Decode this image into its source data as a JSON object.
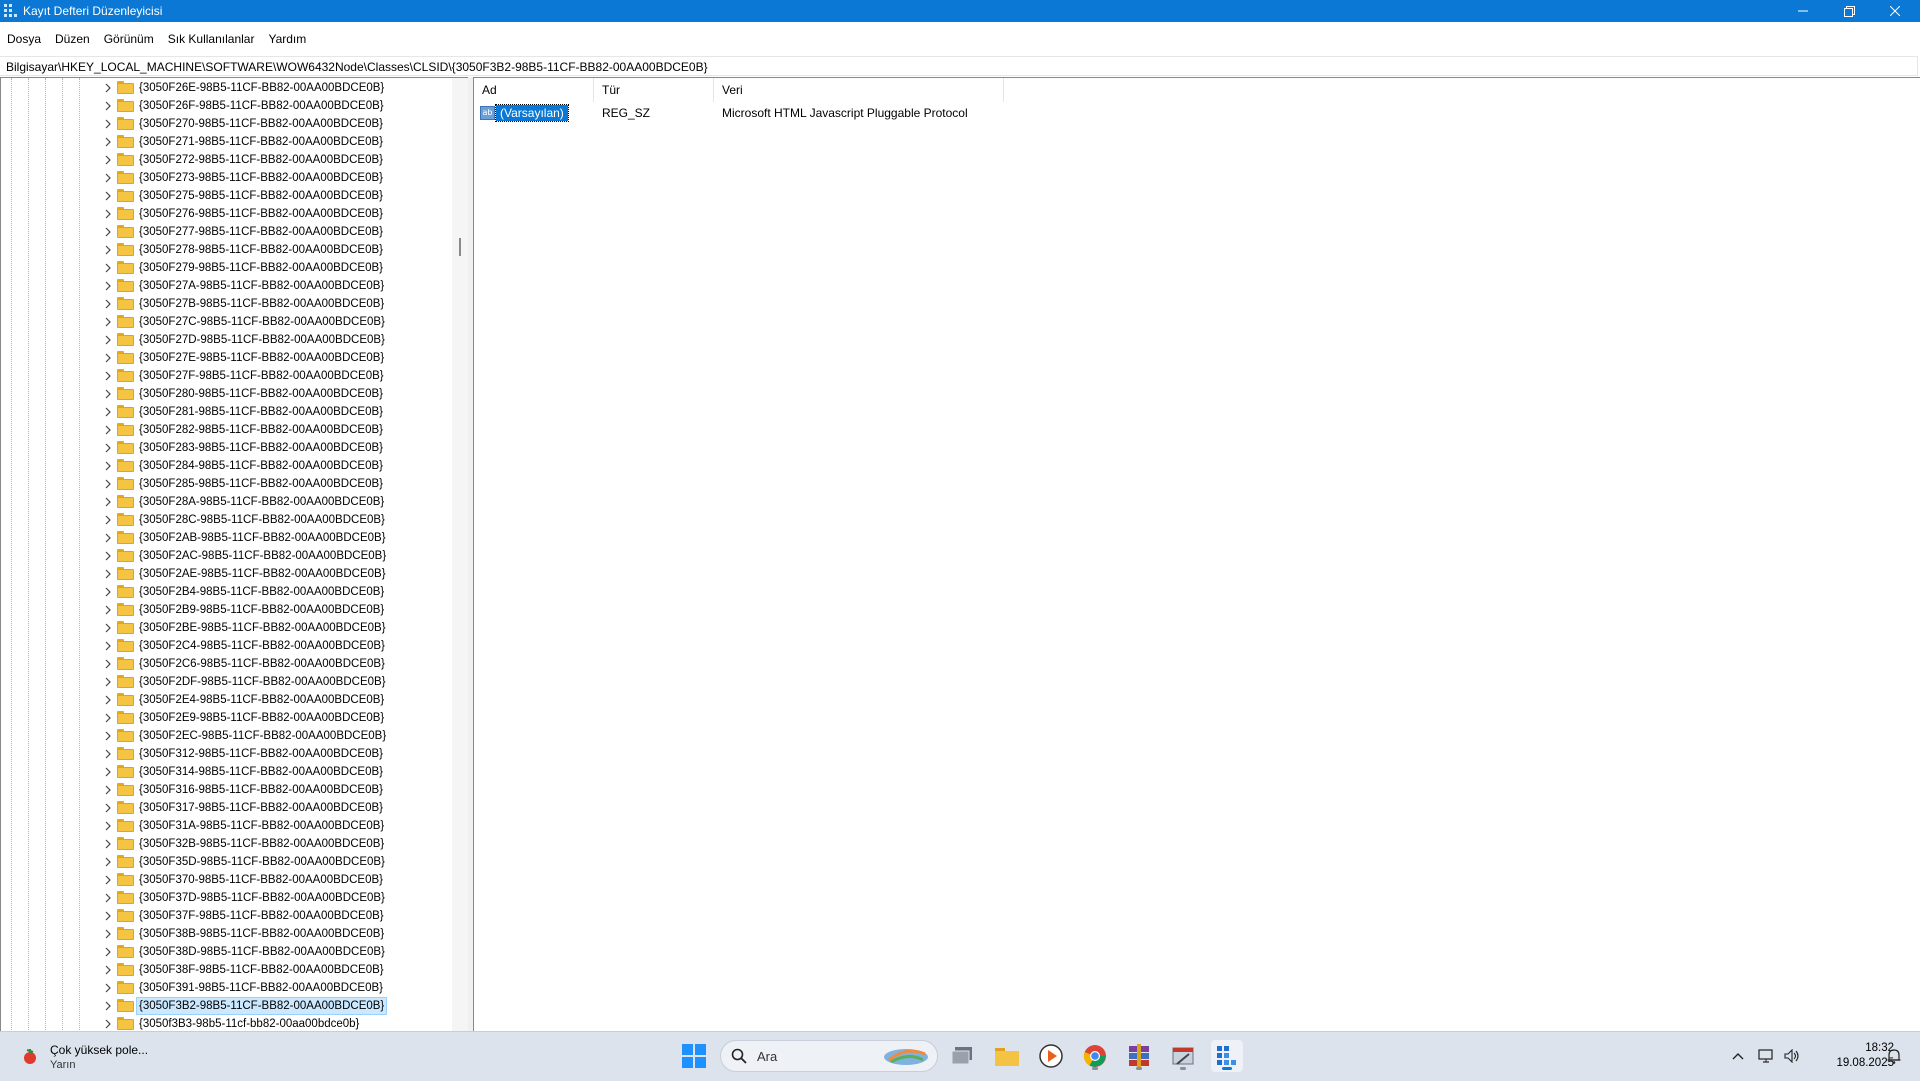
{
  "window": {
    "title": "Kayıt Defteri Düzenleyicisi",
    "minimize_glyph": "—",
    "maximize_glyph": "❐",
    "close_glyph": "✕"
  },
  "menu": [
    "Dosya",
    "Düzen",
    "Görünüm",
    "Sık Kullanılanlar",
    "Yardım"
  ],
  "address": "Bilgisayar\\HKEY_LOCAL_MACHINE\\SOFTWARE\\WOW6432Node\\Classes\\CLSID\\{3050F3B2-98B5-11CF-BB82-00AA00BDCE0B}",
  "tree": {
    "items": [
      "{3050F26E-98B5-11CF-BB82-00AA00BDCE0B}",
      "{3050F26F-98B5-11CF-BB82-00AA00BDCE0B}",
      "{3050F270-98B5-11CF-BB82-00AA00BDCE0B}",
      "{3050F271-98B5-11CF-BB82-00AA00BDCE0B}",
      "{3050F272-98B5-11CF-BB82-00AA00BDCE0B}",
      "{3050F273-98B5-11CF-BB82-00AA00BDCE0B}",
      "{3050F275-98B5-11CF-BB82-00AA00BDCE0B}",
      "{3050F276-98B5-11CF-BB82-00AA00BDCE0B}",
      "{3050F277-98B5-11CF-BB82-00AA00BDCE0B}",
      "{3050F278-98B5-11CF-BB82-00AA00BDCE0B}",
      "{3050F279-98B5-11CF-BB82-00AA00BDCE0B}",
      "{3050F27A-98B5-11CF-BB82-00AA00BDCE0B}",
      "{3050F27B-98B5-11CF-BB82-00AA00BDCE0B}",
      "{3050F27C-98B5-11CF-BB82-00AA00BDCE0B}",
      "{3050F27D-98B5-11CF-BB82-00AA00BDCE0B}",
      "{3050F27E-98B5-11CF-BB82-00AA00BDCE0B}",
      "{3050F27F-98B5-11CF-BB82-00AA00BDCE0B}",
      "{3050F280-98B5-11CF-BB82-00AA00BDCE0B}",
      "{3050F281-98B5-11CF-BB82-00AA00BDCE0B}",
      "{3050F282-98B5-11CF-BB82-00AA00BDCE0B}",
      "{3050F283-98B5-11CF-BB82-00AA00BDCE0B}",
      "{3050F284-98B5-11CF-BB82-00AA00BDCE0B}",
      "{3050F285-98B5-11CF-BB82-00AA00BDCE0B}",
      "{3050F28A-98B5-11CF-BB82-00AA00BDCE0B}",
      "{3050F28C-98B5-11CF-BB82-00AA00BDCE0B}",
      "{3050F2AB-98B5-11CF-BB82-00AA00BDCE0B}",
      "{3050F2AC-98B5-11CF-BB82-00AA00BDCE0B}",
      "{3050F2AE-98B5-11CF-BB82-00AA00BDCE0B}",
      "{3050F2B4-98B5-11CF-BB82-00AA00BDCE0B}",
      "{3050F2B9-98B5-11CF-BB82-00AA00BDCE0B}",
      "{3050F2BE-98B5-11CF-BB82-00AA00BDCE0B}",
      "{3050F2C4-98B5-11CF-BB82-00AA00BDCE0B}",
      "{3050F2C6-98B5-11CF-BB82-00AA00BDCE0B}",
      "{3050F2DF-98B5-11CF-BB82-00AA00BDCE0B}",
      "{3050F2E4-98B5-11CF-BB82-00AA00BDCE0B}",
      "{3050F2E9-98B5-11CF-BB82-00AA00BDCE0B}",
      "{3050F2EC-98B5-11CF-BB82-00AA00BDCE0B}",
      "{3050F312-98B5-11CF-BB82-00AA00BDCE0B}",
      "{3050F314-98B5-11CF-BB82-00AA00BDCE0B}",
      "{3050F316-98B5-11CF-BB82-00AA00BDCE0B}",
      "{3050F317-98B5-11CF-BB82-00AA00BDCE0B}",
      "{3050F31A-98B5-11CF-BB82-00AA00BDCE0B}",
      "{3050F32B-98B5-11CF-BB82-00AA00BDCE0B}",
      "{3050F35D-98B5-11CF-BB82-00AA00BDCE0B}",
      "{3050F370-98B5-11CF-BB82-00AA00BDCE0B}",
      "{3050F37D-98B5-11CF-BB82-00AA00BDCE0B}",
      "{3050F37F-98B5-11CF-BB82-00AA00BDCE0B}",
      "{3050F38B-98B5-11CF-BB82-00AA00BDCE0B}",
      "{3050F38D-98B5-11CF-BB82-00AA00BDCE0B}",
      "{3050F38F-98B5-11CF-BB82-00AA00BDCE0B}",
      "{3050F391-98B5-11CF-BB82-00AA00BDCE0B}",
      "{3050F3B2-98B5-11CF-BB82-00AA00BDCE0B}",
      "{3050f3B3-98b5-11cf-bb82-00aa00bdce0b}"
    ],
    "selected_index": 51
  },
  "list": {
    "headers": [
      "Ad",
      "Tür",
      "Veri"
    ],
    "rows": [
      {
        "name": "(Varsayılan)",
        "type": "REG_SZ",
        "data": "Microsoft HTML Javascript Pluggable Protocol",
        "icon": "ab"
      }
    ]
  },
  "taskbar": {
    "weather_text": "Çok yüksek pole...",
    "weather_sub": "Yarın",
    "search_placeholder": "Ara",
    "time": "18:32",
    "date": "19.08.2025"
  },
  "colors": {
    "titlebar": "#0a78d4",
    "selection": "#0a78d4",
    "tree_selection": "#cce8ff",
    "folder": "#f6c443",
    "taskbar": "#dde3ed"
  }
}
